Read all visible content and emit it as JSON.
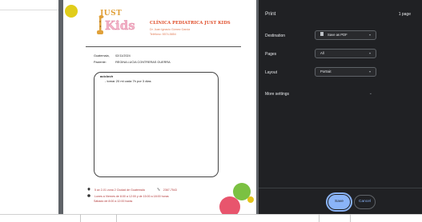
{
  "preview": {
    "clinic": {
      "title": "CLÍNICA PEDIATRICA JUST KIDS",
      "doctor": "Dr. Juan Ignacio Gómez Garcia",
      "phone": "Teléfono: 5574-5854",
      "logo_just": "JUST",
      "logo_kids": "Kids"
    },
    "meta": {
      "city_label": "Guatemala,",
      "date": "02/11/2024",
      "patient_label": "Paciente:",
      "patient_name": "REGINA LUCIA CONTRERAS GUERRA"
    },
    "prescription": {
      "drug": "aciclovir",
      "instruction": "- tomar 20 ml cada 7h por 3 dias"
    },
    "footer": {
      "address": "5 av 2-01 zona 2 Ciudad de Guatemala",
      "phone": "2367-7543",
      "schedule": "Lunes a Viernes de 8:00 a 12:00 y de 15:00 a 18:00 horas",
      "saturday": "Sábado de 8:00 a 12:00 horas"
    }
  },
  "print_panel": {
    "title": "Print",
    "page_count": "1 page",
    "destination": {
      "label": "Destination",
      "value": "Save as PDF"
    },
    "pages": {
      "label": "Pages",
      "value": "All"
    },
    "layout": {
      "label": "Layout",
      "value": "Portrait"
    },
    "more_settings": "More settings",
    "save_label": "Save",
    "cancel_label": "Cancel"
  },
  "colors": {
    "panel_bg": "#202124",
    "accent": "#8ab4f8",
    "clinic_red": "#e0502d",
    "preview_bg": "#5f6368"
  }
}
